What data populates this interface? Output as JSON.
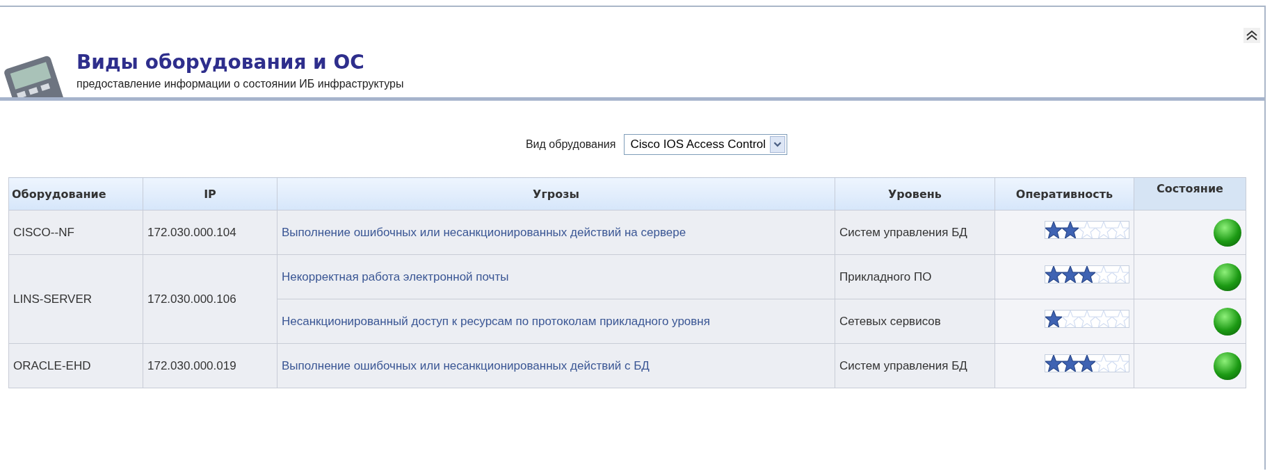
{
  "header": {
    "title": "Виды оборудования и ОС",
    "subtitle": "предоставление информации о состоянии ИБ инфраструктуры"
  },
  "filter": {
    "label": "Вид обрудования",
    "value": "Cisco IOS Access Control"
  },
  "table": {
    "columns": [
      "Оборудование",
      "IP",
      "Угрозы",
      "Уровень",
      "Оперативность",
      "Состояние"
    ],
    "groups": [
      {
        "equipment": "CISCO--NF",
        "ip": "172.030.000.104",
        "threats": [
          {
            "threat": "Выполнение ошибочных или несанкционированных действий на сервере",
            "layer": "Систем управления БД",
            "stars": 2
          }
        ]
      },
      {
        "equipment": "LINS-SERVER",
        "ip": "172.030.000.106",
        "threats": [
          {
            "threat": "Некорректная работа электронной почты",
            "layer": "Прикладного ПО",
            "stars": 3
          },
          {
            "threat": "Несанкционированный доступ к ресурсам по протоколам прикладного уровня",
            "layer": "Сетевых сервисов",
            "stars": 1
          }
        ]
      },
      {
        "equipment": "ORACLE-EHD",
        "ip": "172.030.000.019",
        "threats": [
          {
            "threat": "Выполнение ошибочных или несанкционированных действий с БД",
            "layer": "Систем управления БД",
            "stars": 3
          }
        ]
      }
    ]
  }
}
